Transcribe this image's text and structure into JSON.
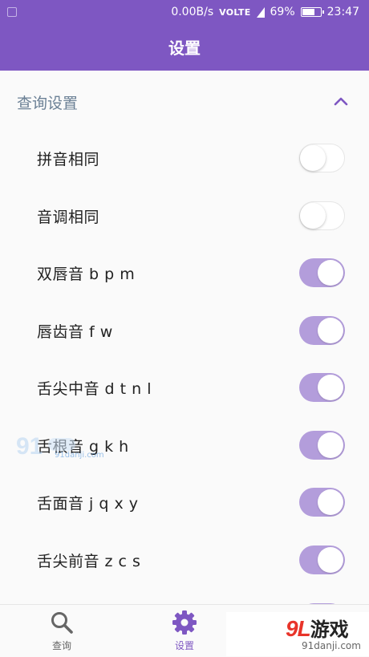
{
  "status_bar": {
    "network_speed": "0.00B/s",
    "volte": "VOLTE",
    "battery_percent": "69%",
    "battery_level": 0.69,
    "time": "23:47"
  },
  "app_bar": {
    "title": "设置"
  },
  "section": {
    "title": "查询设置",
    "expanded": true
  },
  "settings": [
    {
      "label": "拼音相同",
      "on": false
    },
    {
      "label": "音调相同",
      "on": false
    },
    {
      "label": "双唇音 b p m",
      "on": true
    },
    {
      "label": "唇齿音 f w",
      "on": true
    },
    {
      "label": "舌尖中音 d t n l",
      "on": true
    },
    {
      "label": "舌根音 g k h",
      "on": true
    },
    {
      "label": "舌面音 j q x y",
      "on": true
    },
    {
      "label": "舌尖前音 z c s",
      "on": true
    }
  ],
  "bottom_nav": {
    "items": [
      {
        "label": "查询",
        "icon": "search-icon",
        "active": false
      },
      {
        "label": "设置",
        "icon": "gear-icon",
        "active": true
      }
    ]
  },
  "branding": {
    "logo": "9L",
    "name": "游戏",
    "url": "91danji.com",
    "watermark_url": "91danji.com"
  },
  "colors": {
    "primary": "#7e57c2",
    "toggle_on_track": "#b39ddb",
    "section_title": "#6b8095"
  }
}
